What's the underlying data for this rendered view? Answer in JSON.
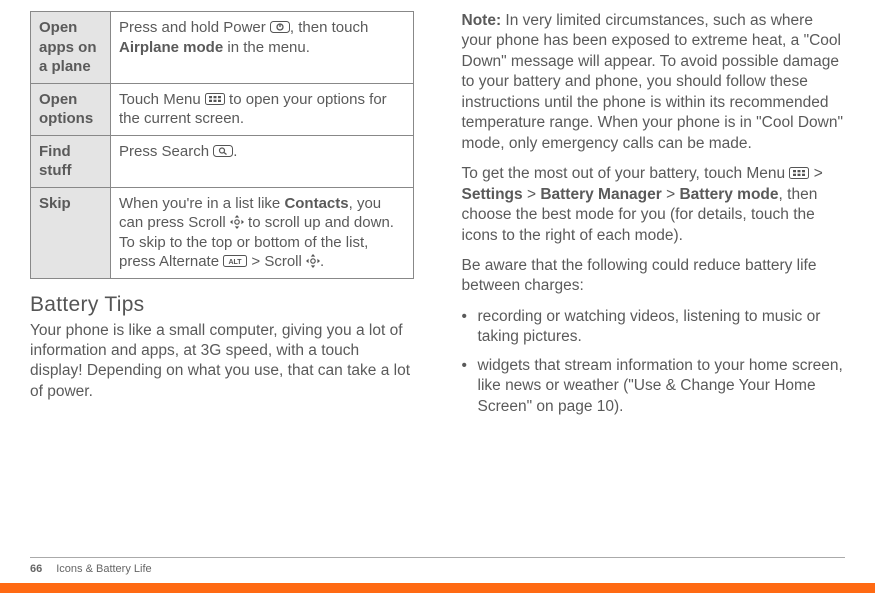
{
  "table": {
    "rows": [
      {
        "label": "Open apps on a plane",
        "desc_pre": "Press and hold Power ",
        "icon": "power",
        "desc_mid": ", then touch ",
        "strong": "Airplane mode",
        "desc_post": " in the menu."
      },
      {
        "label": "Open options",
        "desc_pre": "Touch Menu ",
        "icon": "menu",
        "desc_post": " to open your options for the current screen."
      },
      {
        "label": "Find stuff",
        "desc_pre": "Press Search ",
        "icon": "search",
        "desc_post": "."
      },
      {
        "label": "Skip",
        "desc_pre": "When you're in a list like ",
        "strong1": "Contacts",
        "desc_mid1": ", you can press Scroll ",
        "icon1": "scroll",
        "desc_mid2": " to scroll up and down. To skip to the top or bottom of the list, press Alternate ",
        "icon2": "alt",
        "desc_mid3": " > Scroll ",
        "icon3": "scroll",
        "desc_post": "."
      }
    ]
  },
  "section_heading": "Battery Tips",
  "left_para": "Your phone is like a small computer, giving you a lot of information and apps, at 3G speed, with a touch display! Depending on what you use, that can take a lot of power.",
  "right": {
    "note_label": "Note:",
    "note_body": " In very limited circumstances, such as where your phone has been exposed to extreme heat, a \"Cool Down\" message will appear. To avoid possible damage to your battery and phone, you should follow these instructions until the phone is within its recommended temperature range. When your phone is in \"Cool Down\" mode, only emergency calls can be made.",
    "para2_pre": "To get the most out of your battery, touch Menu ",
    "para2_icon": "menu",
    "para2_mid1": " > ",
    "para2_s1": "Settings",
    "para2_mid2": " > ",
    "para2_s2": "Battery Manager",
    "para2_mid3": " > ",
    "para2_s3": "Battery mode",
    "para2_post": ", then choose the best mode for you (for details, touch the icons to the right of each mode).",
    "para3": "Be aware that the following could reduce battery life between charges:",
    "bullets": [
      "recording or watching videos, listening to music or taking pictures.",
      "widgets that stream information to your home screen, like news or weather (\"Use & Change Your Home Screen\" on page 10)."
    ]
  },
  "footer": {
    "page": "66",
    "section": "Icons & Battery Life"
  }
}
